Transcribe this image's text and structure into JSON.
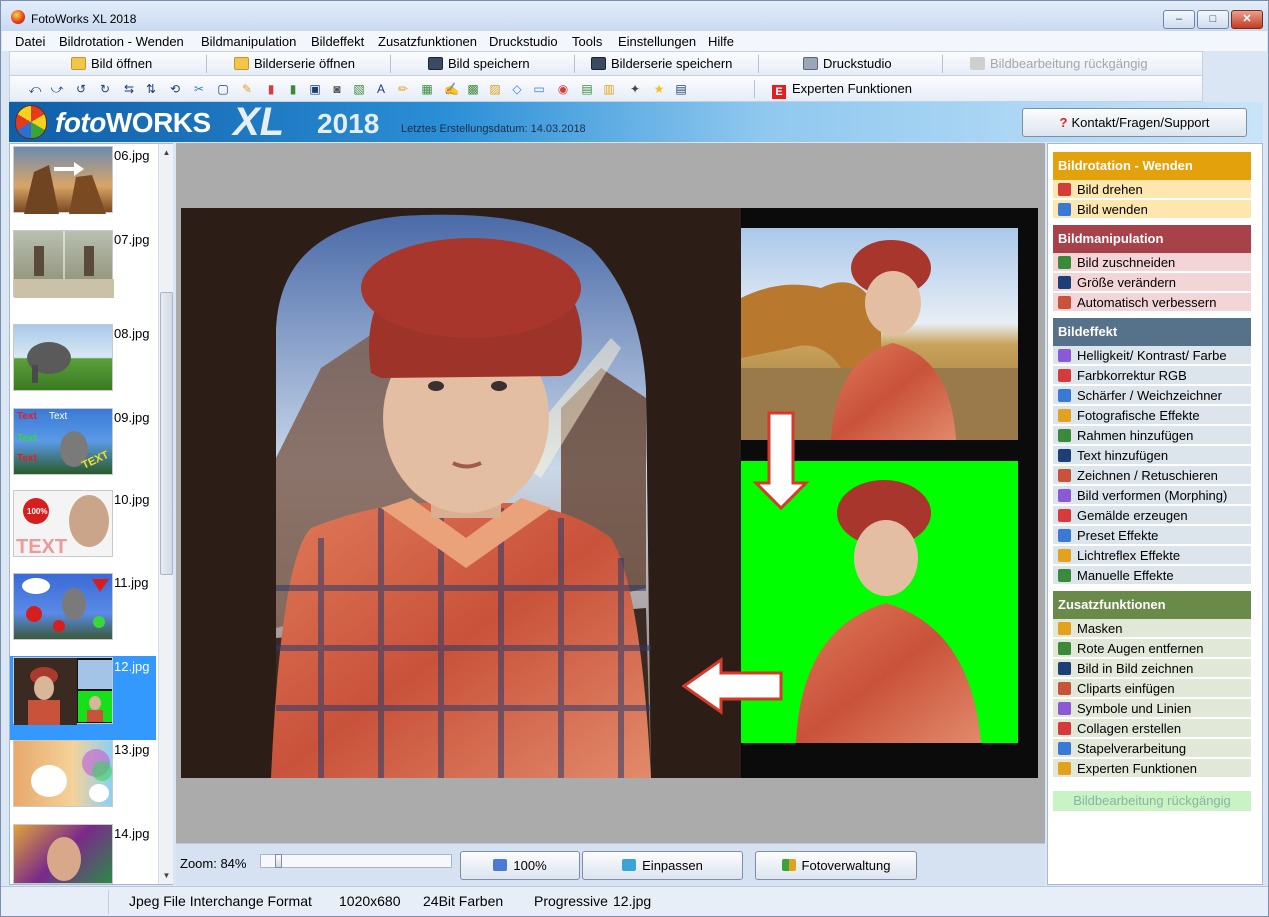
{
  "window": {
    "title": "FotoWorks XL 2018",
    "minimize": "–",
    "maximize": "□",
    "close": "✕"
  },
  "menu": [
    "Datei",
    "Bildrotation - Wenden",
    "Bildmanipulation",
    "Bildeffekt",
    "Zusatzfunktionen",
    "Druckstudio",
    "Tools",
    "Einstellungen",
    "Hilfe"
  ],
  "toolbar": {
    "open_image": "Bild öffnen",
    "open_series": "Bilderserie öffnen",
    "save_image": "Bild speichern",
    "save_series": "Bilderserie speichern",
    "print_studio": "Druckstudio",
    "undo": "Bildbearbeitung rückgängig",
    "expert": "Experten Funktionen"
  },
  "tool_icons": [
    "rotate-left-icon",
    "rotate-right-icon",
    "rotate-ccw-icon",
    "rotate-cw-icon",
    "flip-h-icon",
    "flip-v-icon",
    "flip-icon",
    "crop-icon",
    "resize-icon",
    "auto-improve-icon",
    "brightness-icon",
    "color-rgb-icon",
    "sharpen-icon",
    "photo-effects-icon",
    "frame-icon",
    "text-icon",
    "draw-icon",
    "morph-icon",
    "paint-icon",
    "preset-icon",
    "lightflare-icon",
    "manual-effects-icon",
    "mask-icon",
    "red-eye-icon",
    "pip-icon",
    "clipart-icon",
    "symbols-icon",
    "collage-icon",
    "batch-icon"
  ],
  "banner": {
    "logo_foto": "foto",
    "logo_works": "WORKS",
    "logo_xl": "XL",
    "logo_year": "2018",
    "build_date": "Letztes Erstellungsdatum: 14.03.2018"
  },
  "support_button": "Kontakt/Fragen/Support",
  "thumbnails": [
    {
      "name": "06.jpg"
    },
    {
      "name": "07.jpg"
    },
    {
      "name": "08.jpg"
    },
    {
      "name": "09.jpg"
    },
    {
      "name": "10.jpg"
    },
    {
      "name": "11.jpg"
    },
    {
      "name": "12.jpg",
      "selected": true
    },
    {
      "name": "13.jpg"
    },
    {
      "name": "14.jpg"
    }
  ],
  "zoom": {
    "label": "Zoom: 84%",
    "value": 84
  },
  "view_buttons": {
    "actual": "100%",
    "fit": "Einpassen",
    "manager": "Fotoverwaltung"
  },
  "panel": {
    "sections": [
      {
        "title": "Bildrotation - Wenden",
        "color": "#e3a20c",
        "item_bg": "#fde7ae",
        "items": [
          {
            "label": "Bild drehen",
            "icon": "rotate-icon"
          },
          {
            "label": "Bild wenden",
            "icon": "flip-icon"
          }
        ]
      },
      {
        "title": "Bildmanipulation",
        "color": "#a8424a",
        "item_bg": "#f3d5d7",
        "items": [
          {
            "label": "Bild zuschneiden",
            "icon": "crop-icon"
          },
          {
            "label": "Größe verändern",
            "icon": "resize-icon"
          },
          {
            "label": "Automatisch verbessern",
            "icon": "auto-improve-icon"
          }
        ]
      },
      {
        "title": "Bildeffekt",
        "color": "#56728a",
        "item_bg": "#dde5ec",
        "items": [
          {
            "label": "Helligkeit/ Kontrast/ Farbe",
            "icon": "brightness-icon"
          },
          {
            "label": "Farbkorrektur RGB",
            "icon": "color-rgb-icon"
          },
          {
            "label": "Schärfer / Weichzeichner",
            "icon": "sharpen-icon"
          },
          {
            "label": "Fotografische Effekte",
            "icon": "photo-effects-icon"
          },
          {
            "label": "Rahmen hinzufügen",
            "icon": "frame-icon"
          },
          {
            "label": "Text hinzufügen",
            "icon": "text-icon"
          },
          {
            "label": "Zeichnen / Retuschieren",
            "icon": "draw-icon"
          },
          {
            "label": "Bild verformen (Morphing)",
            "icon": "morph-icon"
          },
          {
            "label": "Gemälde erzeugen",
            "icon": "paint-icon"
          },
          {
            "label": "Preset Effekte",
            "icon": "preset-icon"
          },
          {
            "label": "Lichtreflex Effekte",
            "icon": "lightflare-icon"
          },
          {
            "label": "Manuelle Effekte",
            "icon": "manual-effects-icon"
          }
        ]
      },
      {
        "title": "Zusatzfunktionen",
        "color": "#6a8a4a",
        "item_bg": "#e1e8d8",
        "items": [
          {
            "label": "Masken",
            "icon": "mask-icon"
          },
          {
            "label": "Rote Augen entfernen",
            "icon": "red-eye-icon"
          },
          {
            "label": "Bild in Bild zeichnen",
            "icon": "pip-icon"
          },
          {
            "label": "Cliparts einfügen",
            "icon": "clipart-icon"
          },
          {
            "label": "Symbole und Linien",
            "icon": "symbols-icon"
          },
          {
            "label": "Collagen erstellen",
            "icon": "collage-icon"
          },
          {
            "label": "Stapelverarbeitung",
            "icon": "batch-icon"
          },
          {
            "label": "Experten Funktionen",
            "icon": "expert-icon"
          }
        ]
      }
    ],
    "undo": "Bildbearbeitung rückgängig"
  },
  "status": {
    "format": "Jpeg File Interchange Format",
    "dimensions": "1020x680",
    "depth": "24Bit Farben",
    "mode": "Progressive",
    "file": "12.jpg"
  }
}
